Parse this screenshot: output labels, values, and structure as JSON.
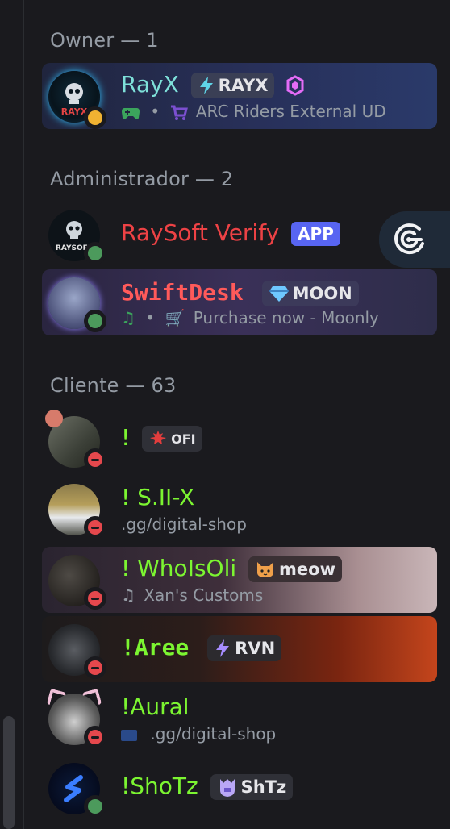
{
  "groups": {
    "owner": "Owner — 1",
    "admin": "Administrador — 2",
    "client": "Cliente — 63"
  },
  "members": {
    "rayx": {
      "name": "RayX",
      "tag": "RAYX",
      "activity": "ARC Riders External UD"
    },
    "raysoft": {
      "name": "RaySoft Verify",
      "app_label": "APP"
    },
    "swiftdesk": {
      "name": "SwiftDesk",
      "tag": "MOON",
      "activity": "Purchase now - Moonly"
    },
    "bang": {
      "name": "!",
      "tag": "OFI"
    },
    "sii": {
      "name": "! S.II-X",
      "activity": ".gg/digital-shop"
    },
    "wholsoli": {
      "name": "! WhoIsOli",
      "tag": "meow",
      "activity": "Xan's Customs"
    },
    "aree": {
      "name": "!Aree",
      "tag": "RVN"
    },
    "aural": {
      "name": "!Aural",
      "activity": ".gg/digital-shop"
    },
    "shotz": {
      "name": "!ShoTz",
      "tag": "ShTz"
    }
  },
  "colors": {
    "background": "#1a1a1e",
    "owner_name": "#7ee0d9",
    "admin_name": "#ed4245",
    "client_name": "#7cf531",
    "app_badge": "#5865f2",
    "online": "#4c9a5c",
    "dnd": "#e5484d",
    "idle": "#f0b232"
  },
  "icons": {
    "rayx": [
      "controller-icon",
      "shop-cart-icon",
      "crystal-badge-icon",
      "lightning-icon"
    ],
    "raysoft": [
      "radar-app-icon"
    ],
    "swiftdesk": [
      "music-note-icon",
      "cart-icon",
      "diamond-icon"
    ],
    "bang": [
      "maple-leaf-icon"
    ],
    "wholsoli": [
      "cat-icon",
      "music-note-icon"
    ],
    "aree": [
      "lightning-icon"
    ],
    "aural": [
      "server-tag-icon"
    ],
    "shotz": [
      "crown-shield-icon"
    ]
  }
}
